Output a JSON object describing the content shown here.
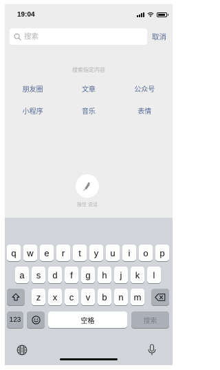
{
  "status_bar": {
    "time": "19:04"
  },
  "search": {
    "placeholder": "搜索",
    "cancel_label": "取消"
  },
  "hints": {
    "title": "搜索指定内容",
    "rows": [
      [
        "朋友圈",
        "文章",
        "公众号"
      ],
      [
        "小程序",
        "音乐",
        "表情"
      ]
    ]
  },
  "voice": {
    "label": "按住 说话"
  },
  "keyboard": {
    "row1": [
      "q",
      "w",
      "e",
      "r",
      "t",
      "y",
      "u",
      "i",
      "o",
      "p"
    ],
    "row2": [
      "a",
      "s",
      "d",
      "f",
      "g",
      "h",
      "j",
      "k",
      "l"
    ],
    "row3": [
      "z",
      "x",
      "c",
      "v",
      "b",
      "n",
      "m"
    ],
    "numbers_label": "123",
    "space_label": "空格",
    "search_label": "搜索"
  },
  "icons": {
    "shift": "shift-icon",
    "delete": "delete-icon",
    "emoji": "emoji-icon",
    "globe": "globe-icon",
    "mic": "microphone-icon"
  },
  "colors": {
    "link": "#576b95",
    "background": "#ededed",
    "keyboard": "#d1d4d9"
  }
}
